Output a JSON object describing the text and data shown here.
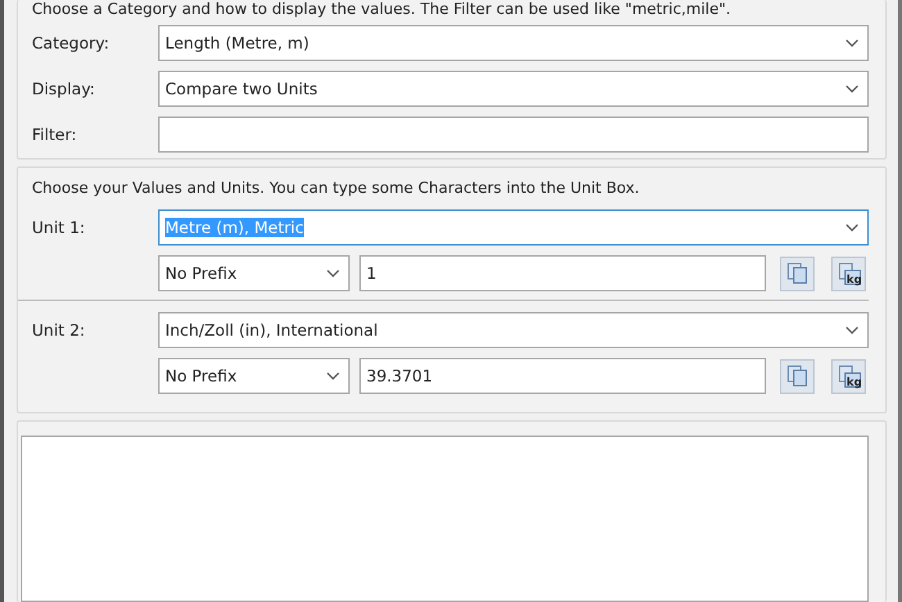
{
  "category_group": {
    "hint": "Choose a Category and how to display the values. The Filter can be used like \"metric,mile\".",
    "fields": [
      {
        "label": "Category:",
        "kind": "combo",
        "value": "Length (Metre, m)"
      },
      {
        "label": "Display:",
        "kind": "combo",
        "value": "Compare two Units"
      },
      {
        "label": "Filter:",
        "kind": "text"
      }
    ]
  },
  "units_group": {
    "hint": "Choose your Values and Units. You can type some Characters into the Unit Box.",
    "units": [
      {
        "label": "Unit 1:",
        "unit": "Metre (m), Metric",
        "text_selected": true,
        "prefix": "No Prefix",
        "value": "1",
        "unit_button_text": "kg"
      },
      {
        "label": "Unit 2:",
        "unit": "Inch/Zoll (in), International",
        "text_selected": false,
        "prefix": "No Prefix",
        "value": "39.3701",
        "unit_button_text": "kg"
      }
    ]
  }
}
